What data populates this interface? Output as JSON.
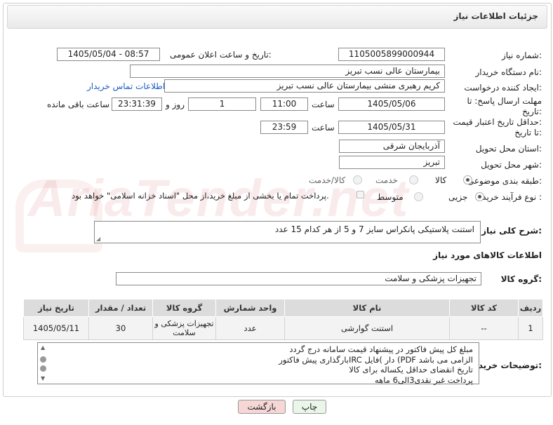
{
  "header": {
    "title": "جزئیات اطلاعات نیاز"
  },
  "watermark": {
    "text": "AriaTender.net"
  },
  "fields": {
    "need_number_label": "شماره نیاز:",
    "need_number": "1105005899000944",
    "announce_label": "تاریخ و ساعت اعلان عمومی:",
    "announce_value": "1405/05/04 - 08:57",
    "buyer_org_label": "نام دستگاه خریدار:",
    "buyer_org": "بیمارستان عالی نسب تبریز",
    "requester_label": "ایجاد کننده درخواست:",
    "requester": "کریم رهبری منشی بیمارستان عالی نسب تبریز",
    "buyer_contact_link": "اطلاعات تماس خریدار",
    "reply_deadline_label_1": "مهلت ارسال پاسخ: تا",
    "reply_deadline_label_2": "تاریخ:",
    "reply_date": "1405/05/06",
    "time_label": "ساعت",
    "reply_time": "11:00",
    "days_value": "1",
    "days_label": "روز و",
    "remaining_time": "23:31:39",
    "remaining_label": "ساعت باقی مانده",
    "price_validity_label_1": "حداقل تاریخ اعتبار قیمت:",
    "price_validity_label_2": "تا تاریخ:",
    "validity_date": "1405/05/31",
    "validity_time": "23:59",
    "province_label": "استان محل تحویل:",
    "province": "آذربایجان شرقی",
    "city_label": "شهر محل تحویل:",
    "city": "تبریز",
    "category_label": "طبقه بندی موضوعی:",
    "category_goods": "کالا",
    "category_service": "خدمت",
    "category_both": "کالا/خدمت",
    "process_label": "نوع فرآیند خرید :",
    "process_partial": "جزیی",
    "process_medium": "متوسط",
    "payment_note": "پرداخت تمام یا بخشی از مبلغ خرید،از محل \"اسناد خزانه اسلامی\" خواهد بود."
  },
  "description": {
    "label": "شرح کلی نیاز:",
    "text": "استنت پلاستیکی پانکراس سایز 7 و 5 از هر کدام 15 عدد"
  },
  "goods_info": {
    "title": "اطلاعات کالاهای مورد نیاز",
    "group_label": "گروه کالا:",
    "group_value": "تجهیزات پزشکی و سلامت"
  },
  "table": {
    "headers": [
      "ردیف",
      "کد کالا",
      "نام کالا",
      "واحد شمارش",
      "گروه کالا",
      "تعداد / مقدار",
      "تاریخ نیاز"
    ],
    "rows": [
      {
        "row": "1",
        "code": "--",
        "name": "استنت گوارشی",
        "unit": "عدد",
        "group": "تجهیزات پزشکی و سلامت",
        "qty": "30",
        "date": "1405/05/11"
      }
    ]
  },
  "buyer_notes": {
    "label": "توضیحات خریدار:",
    "lines": [
      "مبلغ کل پیش فاکتور در پیشنهاد قیمت سامانه درج گردد",
      "بارگذاری پیش فاکتورIRC دار )فایل (PDF الزامی می باشد",
      "تاریخ انقضای حداقل یکساله برای کالا",
      "پرداخت غیر نقدی3الی6 ماهه"
    ]
  },
  "buttons": {
    "print": "چاپ",
    "back": "بازگشت"
  },
  "colors": {
    "back_button_bg": "#f7d6d6",
    "print_button_bg": "#eaf6ea",
    "link": "#1d5cc4"
  }
}
